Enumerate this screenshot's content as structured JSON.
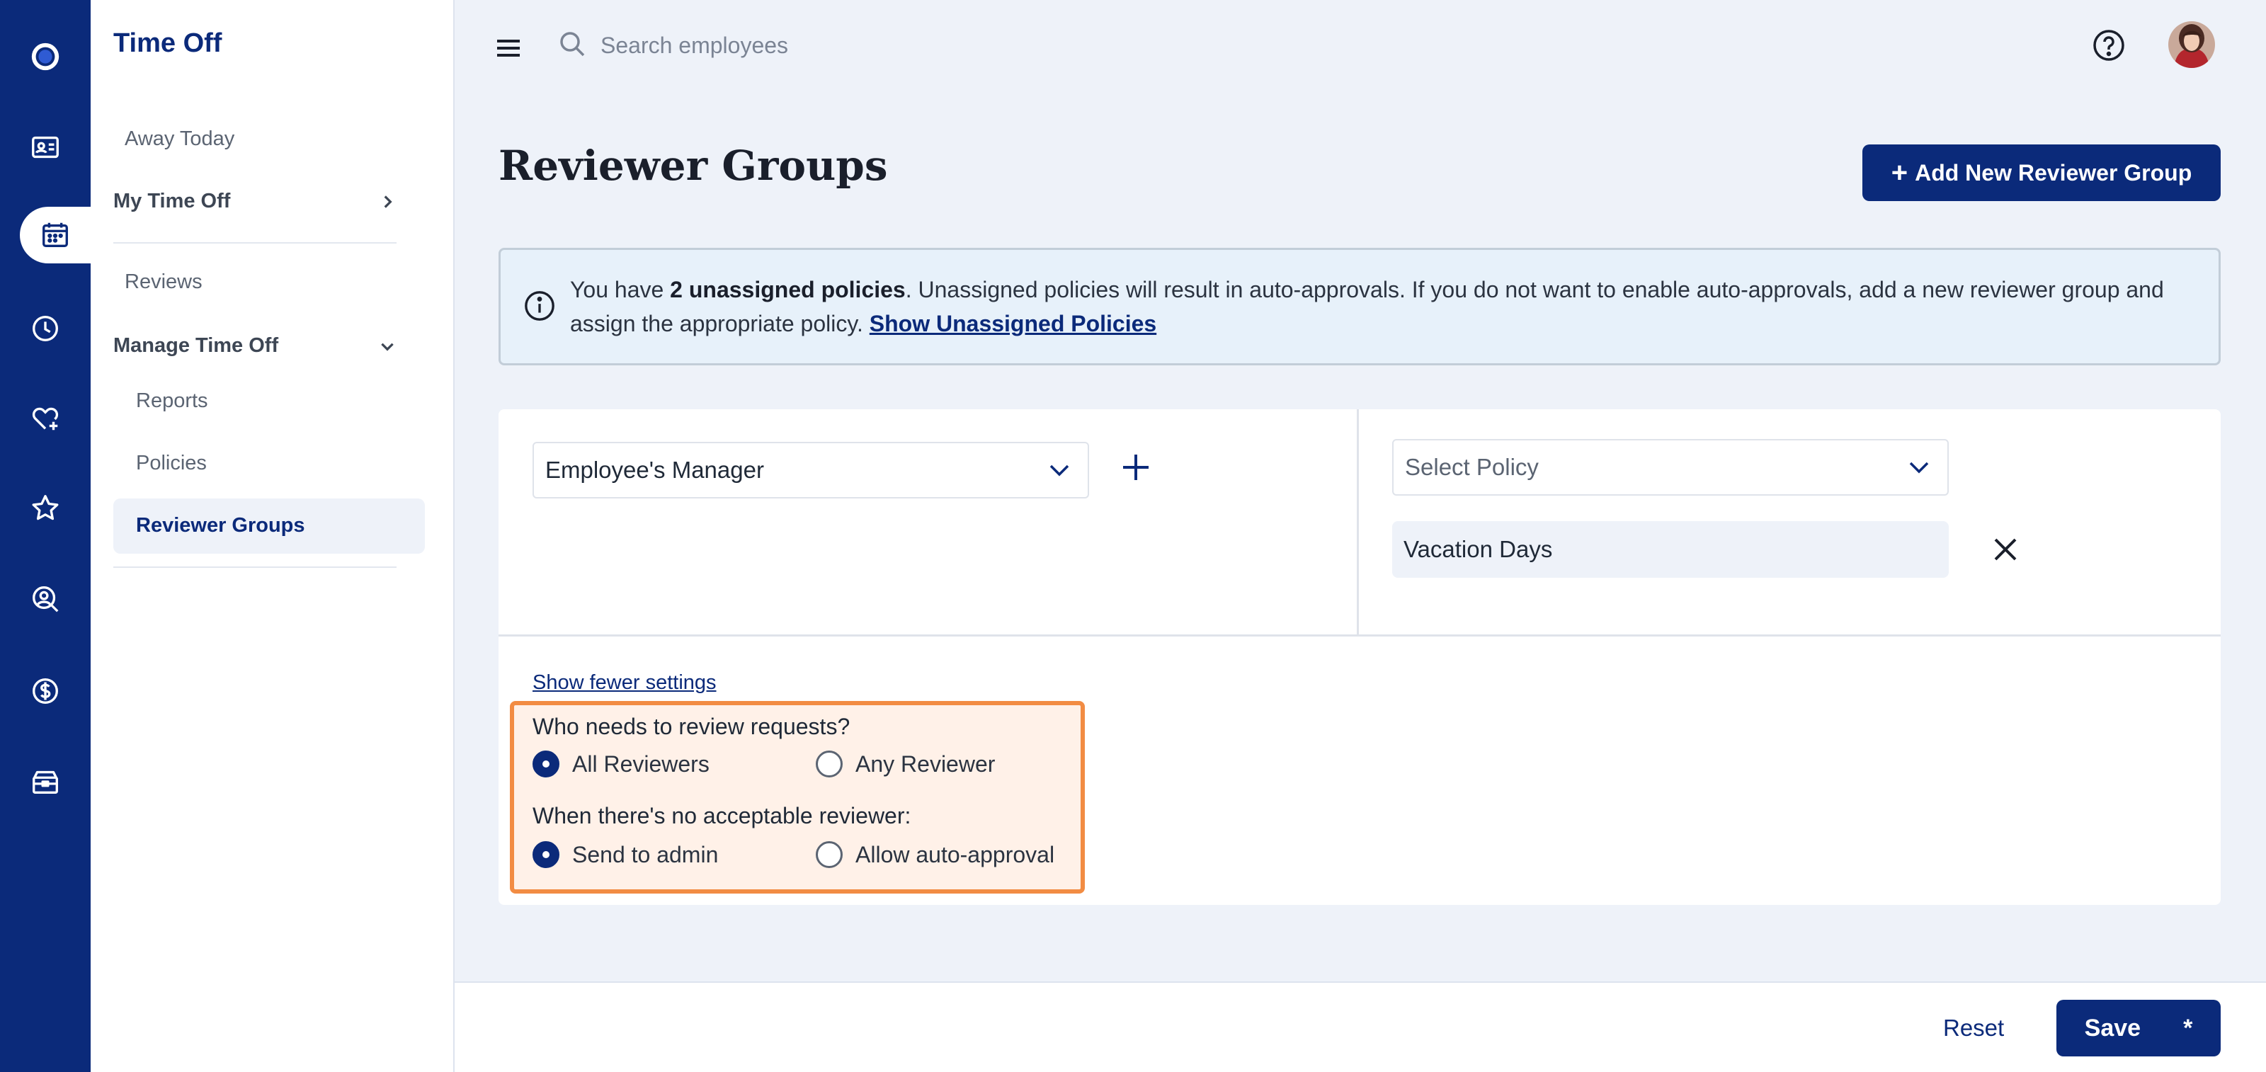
{
  "app": {
    "section_title": "Time Off"
  },
  "rail": {
    "items": [
      {
        "icon": "app-logo-icon"
      },
      {
        "icon": "employee-card-icon"
      },
      {
        "icon": "calendar-icon",
        "active": true
      },
      {
        "icon": "clock-icon"
      },
      {
        "icon": "heart-plus-icon"
      },
      {
        "icon": "star-icon"
      },
      {
        "icon": "person-search-icon"
      },
      {
        "icon": "dollar-icon"
      },
      {
        "icon": "toolbox-icon"
      }
    ]
  },
  "sidebar": {
    "away_today": "Away Today",
    "my_time_off": "My Time Off",
    "reviews": "Reviews",
    "manage_time_off": "Manage Time Off",
    "reports": "Reports",
    "policies": "Policies",
    "reviewer_groups": "Reviewer Groups"
  },
  "topbar": {
    "search_placeholder": "Search employees"
  },
  "page": {
    "title": "Reviewer Groups",
    "add_button": "Add New Reviewer Group"
  },
  "alert": {
    "prefix": "You have ",
    "count_text": "2 unassigned policies",
    "message": ". Unassigned policies will result in auto-approvals. If you do not want to enable auto-approvals, add a new reviewer group and assign the appropriate policy. ",
    "link": "Show Unassigned Policies"
  },
  "group": {
    "reviewer_select": "Employee's Manager",
    "policy_placeholder": "Select Policy",
    "policies": [
      "Vacation Days"
    ],
    "show_fewer": "Show fewer settings",
    "review_question": "Who needs to review requests?",
    "review_options": [
      {
        "label": "All Reviewers",
        "checked": true
      },
      {
        "label": "Any Reviewer",
        "checked": false
      }
    ],
    "fallback_question": "When there's no acceptable reviewer:",
    "fallback_options": [
      {
        "label": "Send to admin",
        "checked": true
      },
      {
        "label": "Allow auto-approval",
        "checked": false
      }
    ]
  },
  "footer": {
    "reset": "Reset",
    "save": "Save",
    "unsaved_marker": "*"
  },
  "colors": {
    "brand": "#0b2a7a",
    "highlight_border": "#f28c43",
    "highlight_fill": "#fff1e8",
    "alert_fill": "#e7f1fa"
  }
}
